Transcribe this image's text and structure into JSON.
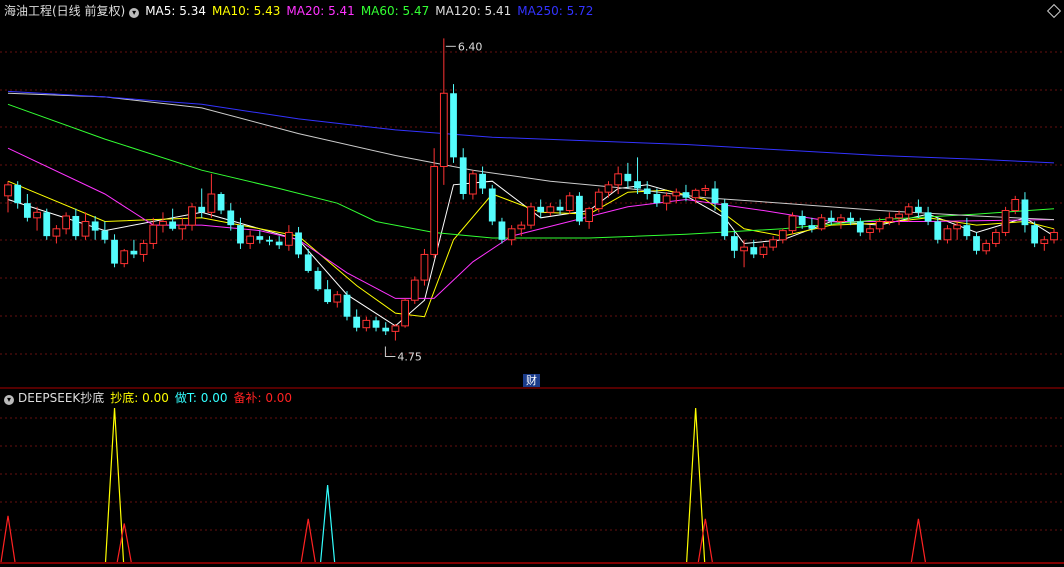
{
  "main": {
    "title": "海油工程(日线 前复权)",
    "ma": [
      {
        "label": "MA5: 5.34",
        "color": "#ffffff"
      },
      {
        "label": "MA10: 5.43",
        "color": "#ffff00"
      },
      {
        "label": "MA20: 5.41",
        "color": "#ff33ff"
      },
      {
        "label": "MA60: 5.47",
        "color": "#33ff33"
      },
      {
        "label": "MA120: 5.41",
        "color": "#dddddd"
      },
      {
        "label": "MA250: 5.72",
        "color": "#3333ff"
      }
    ],
    "high_label": "6.40",
    "low_label": "4.75",
    "event_badge": "财"
  },
  "indicator": {
    "title": "DEEPSEEK抄底",
    "series_labels": [
      {
        "label": "抄底: 0.00",
        "color": "#ffff00"
      },
      {
        "label": "做T: 0.00",
        "color": "#33ffff"
      },
      {
        "label": "备补: 0.00",
        "color": "#ff2222"
      }
    ]
  },
  "chart_data": [
    {
      "type": "candlestick",
      "title": "海油工程(日线 前复权)",
      "ylim": [
        4.6,
        6.5
      ],
      "high": 6.4,
      "low": 4.75,
      "ohlc": [
        [
          5.54,
          5.62,
          5.45,
          5.6
        ],
        [
          5.6,
          5.62,
          5.47,
          5.5
        ],
        [
          5.5,
          5.55,
          5.4,
          5.42
        ],
        [
          5.42,
          5.48,
          5.35,
          5.45
        ],
        [
          5.45,
          5.47,
          5.3,
          5.32
        ],
        [
          5.32,
          5.38,
          5.28,
          5.36
        ],
        [
          5.36,
          5.45,
          5.33,
          5.43
        ],
        [
          5.43,
          5.47,
          5.3,
          5.32
        ],
        [
          5.32,
          5.45,
          5.3,
          5.4
        ],
        [
          5.4,
          5.43,
          5.3,
          5.35
        ],
        [
          5.35,
          5.4,
          5.28,
          5.3
        ],
        [
          5.3,
          5.33,
          5.15,
          5.17
        ],
        [
          5.17,
          5.25,
          5.15,
          5.24
        ],
        [
          5.24,
          5.3,
          5.2,
          5.22
        ],
        [
          5.22,
          5.3,
          5.18,
          5.28
        ],
        [
          5.28,
          5.42,
          5.25,
          5.38
        ],
        [
          5.38,
          5.45,
          5.34,
          5.4
        ],
        [
          5.4,
          5.47,
          5.35,
          5.36
        ],
        [
          5.36,
          5.42,
          5.3,
          5.38
        ],
        [
          5.38,
          5.5,
          5.35,
          5.48
        ],
        [
          5.48,
          5.58,
          5.42,
          5.45
        ],
        [
          5.45,
          5.66,
          5.42,
          5.55
        ],
        [
          5.55,
          5.56,
          5.44,
          5.46
        ],
        [
          5.46,
          5.5,
          5.35,
          5.38
        ],
        [
          5.38,
          5.42,
          5.25,
          5.28
        ],
        [
          5.28,
          5.35,
          5.25,
          5.32
        ],
        [
          5.32,
          5.35,
          5.28,
          5.3
        ],
        [
          5.3,
          5.32,
          5.27,
          5.29
        ],
        [
          5.29,
          5.32,
          5.25,
          5.27
        ],
        [
          5.27,
          5.38,
          5.24,
          5.34
        ],
        [
          5.34,
          5.37,
          5.2,
          5.22
        ],
        [
          5.22,
          5.25,
          5.12,
          5.13
        ],
        [
          5.13,
          5.15,
          5.02,
          5.03
        ],
        [
          5.03,
          5.08,
          4.95,
          4.96
        ],
        [
          4.96,
          5.02,
          4.93,
          5.0
        ],
        [
          5.0,
          5.02,
          4.86,
          4.88
        ],
        [
          4.88,
          4.92,
          4.8,
          4.82
        ],
        [
          4.82,
          4.88,
          4.8,
          4.86
        ],
        [
          4.86,
          4.88,
          4.8,
          4.82
        ],
        [
          4.82,
          4.85,
          4.78,
          4.8
        ],
        [
          4.8,
          4.84,
          4.75,
          4.83
        ],
        [
          4.83,
          4.98,
          4.82,
          4.97
        ],
        [
          4.97,
          5.1,
          4.95,
          5.08
        ],
        [
          5.08,
          5.25,
          5.05,
          5.22
        ],
        [
          5.22,
          5.8,
          5.2,
          5.7
        ],
        [
          5.7,
          6.4,
          5.6,
          6.1
        ],
        [
          6.1,
          6.15,
          5.72,
          5.75
        ],
        [
          5.75,
          5.8,
          5.52,
          5.55
        ],
        [
          5.55,
          5.68,
          5.52,
          5.66
        ],
        [
          5.66,
          5.7,
          5.55,
          5.58
        ],
        [
          5.58,
          5.6,
          5.38,
          5.4
        ],
        [
          5.4,
          5.42,
          5.28,
          5.3
        ],
        [
          5.3,
          5.38,
          5.27,
          5.36
        ],
        [
          5.36,
          5.4,
          5.32,
          5.38
        ],
        [
          5.38,
          5.5,
          5.36,
          5.48
        ],
        [
          5.48,
          5.52,
          5.42,
          5.45
        ],
        [
          5.45,
          5.5,
          5.43,
          5.48
        ],
        [
          5.48,
          5.52,
          5.44,
          5.46
        ],
        [
          5.46,
          5.56,
          5.44,
          5.54
        ],
        [
          5.54,
          5.56,
          5.38,
          5.4
        ],
        [
          5.4,
          5.48,
          5.36,
          5.47
        ],
        [
          5.47,
          5.58,
          5.45,
          5.56
        ],
        [
          5.56,
          5.62,
          5.53,
          5.6
        ],
        [
          5.6,
          5.7,
          5.55,
          5.66
        ],
        [
          5.66,
          5.72,
          5.58,
          5.62
        ],
        [
          5.62,
          5.75,
          5.55,
          5.58
        ],
        [
          5.58,
          5.62,
          5.52,
          5.55
        ],
        [
          5.55,
          5.58,
          5.48,
          5.5
        ],
        [
          5.5,
          5.56,
          5.46,
          5.54
        ],
        [
          5.54,
          5.58,
          5.5,
          5.56
        ],
        [
          5.56,
          5.6,
          5.51,
          5.53
        ],
        [
          5.53,
          5.58,
          5.5,
          5.57
        ],
        [
          5.57,
          5.6,
          5.54,
          5.58
        ],
        [
          5.58,
          5.62,
          5.46,
          5.5
        ],
        [
          5.5,
          5.52,
          5.3,
          5.32
        ],
        [
          5.32,
          5.35,
          5.2,
          5.24
        ],
        [
          5.24,
          5.3,
          5.15,
          5.26
        ],
        [
          5.26,
          5.3,
          5.2,
          5.22
        ],
        [
          5.22,
          5.28,
          5.2,
          5.26
        ],
        [
          5.26,
          5.32,
          5.24,
          5.3
        ],
        [
          5.3,
          5.36,
          5.28,
          5.35
        ],
        [
          5.35,
          5.45,
          5.33,
          5.43
        ],
        [
          5.43,
          5.46,
          5.36,
          5.38
        ],
        [
          5.38,
          5.42,
          5.34,
          5.36
        ],
        [
          5.36,
          5.44,
          5.35,
          5.42
        ],
        [
          5.42,
          5.46,
          5.38,
          5.4
        ],
        [
          5.4,
          5.44,
          5.36,
          5.42
        ],
        [
          5.42,
          5.45,
          5.38,
          5.4
        ],
        [
          5.4,
          5.42,
          5.32,
          5.34
        ],
        [
          5.34,
          5.38,
          5.3,
          5.36
        ],
        [
          5.36,
          5.42,
          5.34,
          5.4
        ],
        [
          5.4,
          5.45,
          5.38,
          5.42
        ],
        [
          5.42,
          5.46,
          5.38,
          5.44
        ],
        [
          5.44,
          5.5,
          5.4,
          5.48
        ],
        [
          5.48,
          5.52,
          5.42,
          5.45
        ],
        [
          5.45,
          5.48,
          5.38,
          5.4
        ],
        [
          5.4,
          5.42,
          5.28,
          5.3
        ],
        [
          5.3,
          5.38,
          5.28,
          5.36
        ],
        [
          5.36,
          5.4,
          5.3,
          5.38
        ],
        [
          5.38,
          5.42,
          5.3,
          5.32
        ],
        [
          5.32,
          5.34,
          5.22,
          5.24
        ],
        [
          5.24,
          5.3,
          5.22,
          5.28
        ],
        [
          5.28,
          5.36,
          5.26,
          5.34
        ],
        [
          5.34,
          5.48,
          5.32,
          5.46
        ],
        [
          5.46,
          5.54,
          5.44,
          5.52
        ],
        [
          5.52,
          5.56,
          5.34,
          5.38
        ],
        [
          5.38,
          5.4,
          5.26,
          5.28
        ],
        [
          5.28,
          5.32,
          5.24,
          5.3
        ],
        [
          5.3,
          5.36,
          5.28,
          5.34
        ]
      ],
      "ma_lines": [
        {
          "name": "MA5",
          "color": "#ffffff",
          "values": [
            [
              0,
              5.52
            ],
            [
              10,
              5.35
            ],
            [
              20,
              5.45
            ],
            [
              30,
              5.3
            ],
            [
              35,
              5.0
            ],
            [
              40,
              4.83
            ],
            [
              43,
              4.97
            ],
            [
              46,
              5.6
            ],
            [
              50,
              5.62
            ],
            [
              55,
              5.42
            ],
            [
              60,
              5.46
            ],
            [
              63,
              5.58
            ],
            [
              66,
              5.6
            ],
            [
              70,
              5.54
            ],
            [
              74,
              5.42
            ],
            [
              76,
              5.28
            ],
            [
              80,
              5.3
            ],
            [
              85,
              5.4
            ],
            [
              90,
              5.38
            ],
            [
              95,
              5.44
            ],
            [
              100,
              5.34
            ],
            [
              105,
              5.42
            ],
            [
              108,
              5.32
            ]
          ]
        },
        {
          "name": "MA10",
          "color": "#ffff00",
          "values": [
            [
              0,
              5.62
            ],
            [
              10,
              5.4
            ],
            [
              20,
              5.42
            ],
            [
              30,
              5.32
            ],
            [
              36,
              5.05
            ],
            [
              40,
              4.9
            ],
            [
              43,
              4.88
            ],
            [
              46,
              5.3
            ],
            [
              50,
              5.55
            ],
            [
              55,
              5.45
            ],
            [
              60,
              5.44
            ],
            [
              64,
              5.56
            ],
            [
              68,
              5.57
            ],
            [
              72,
              5.52
            ],
            [
              76,
              5.36
            ],
            [
              80,
              5.32
            ],
            [
              85,
              5.38
            ],
            [
              90,
              5.39
            ],
            [
              95,
              5.42
            ],
            [
              100,
              5.38
            ],
            [
              105,
              5.4
            ],
            [
              108,
              5.36
            ]
          ]
        },
        {
          "name": "MA20",
          "color": "#ff33ff",
          "values": [
            [
              0,
              5.8
            ],
            [
              10,
              5.55
            ],
            [
              15,
              5.38
            ],
            [
              20,
              5.38
            ],
            [
              26,
              5.35
            ],
            [
              30,
              5.3
            ],
            [
              35,
              5.12
            ],
            [
              40,
              4.98
            ],
            [
              44,
              4.98
            ],
            [
              48,
              5.18
            ],
            [
              52,
              5.32
            ],
            [
              58,
              5.4
            ],
            [
              64,
              5.48
            ],
            [
              70,
              5.52
            ],
            [
              78,
              5.46
            ],
            [
              85,
              5.4
            ],
            [
              95,
              5.4
            ],
            [
              108,
              5.41
            ]
          ]
        },
        {
          "name": "MA60",
          "color": "#33ff33",
          "values": [
            [
              0,
              6.04
            ],
            [
              10,
              5.85
            ],
            [
              20,
              5.68
            ],
            [
              28,
              5.58
            ],
            [
              34,
              5.5
            ],
            [
              38,
              5.4
            ],
            [
              44,
              5.34
            ],
            [
              50,
              5.31
            ],
            [
              60,
              5.31
            ],
            [
              70,
              5.33
            ],
            [
              80,
              5.36
            ],
            [
              90,
              5.41
            ],
            [
              100,
              5.44
            ],
            [
              108,
              5.47
            ]
          ]
        },
        {
          "name": "MA120",
          "color": "#cccccc",
          "values": [
            [
              0,
              6.1
            ],
            [
              10,
              6.08
            ],
            [
              20,
              6.02
            ],
            [
              30,
              5.88
            ],
            [
              40,
              5.76
            ],
            [
              48,
              5.68
            ],
            [
              56,
              5.62
            ],
            [
              64,
              5.58
            ],
            [
              72,
              5.53
            ],
            [
              80,
              5.5
            ],
            [
              90,
              5.46
            ],
            [
              100,
              5.43
            ],
            [
              108,
              5.41
            ]
          ]
        },
        {
          "name": "MA250",
          "color": "#3333ff",
          "values": [
            [
              0,
              6.11
            ],
            [
              10,
              6.08
            ],
            [
              20,
              6.04
            ],
            [
              30,
              5.96
            ],
            [
              40,
              5.9
            ],
            [
              50,
              5.86
            ],
            [
              60,
              5.84
            ],
            [
              70,
              5.82
            ],
            [
              80,
              5.79
            ],
            [
              90,
              5.76
            ],
            [
              100,
              5.74
            ],
            [
              108,
              5.72
            ]
          ]
        }
      ]
    },
    {
      "type": "line",
      "title": "DEEPSEEK抄底",
      "ylim": [
        0,
        1
      ],
      "series": [
        {
          "name": "抄底",
          "color": "#ffff00",
          "spikes": [
            [
              11,
              1.0
            ],
            [
              71,
              1.0
            ]
          ]
        },
        {
          "name": "做T",
          "color": "#33ffff",
          "spikes": [
            [
              33,
              0.5
            ]
          ]
        },
        {
          "name": "备补",
          "color": "#ff2222",
          "spikes": [
            [
              0,
              0.3
            ],
            [
              12,
              0.25
            ],
            [
              31,
              0.28
            ],
            [
              72,
              0.28
            ],
            [
              94,
              0.28
            ]
          ]
        }
      ]
    }
  ]
}
